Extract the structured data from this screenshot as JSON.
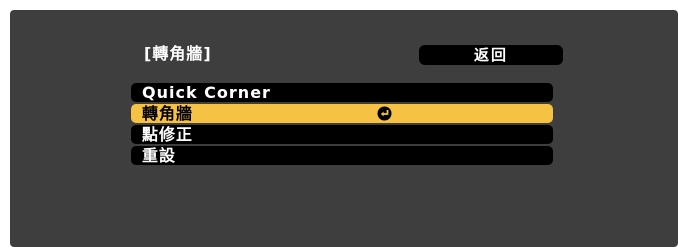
{
  "menu": {
    "title": "[轉角牆]",
    "back_label": "返回",
    "items": [
      {
        "label": "Quick Corner"
      },
      {
        "label": "轉角牆"
      },
      {
        "label": "點修正"
      },
      {
        "label": "重設"
      }
    ],
    "selected_index": 1,
    "selected_item_icon": "enter-icon"
  },
  "colors": {
    "panel_background": "#3e3e3e",
    "item_background": "#000000",
    "selected_background": "#f6c243",
    "text": "#ffffff",
    "selected_text": "#000000"
  }
}
